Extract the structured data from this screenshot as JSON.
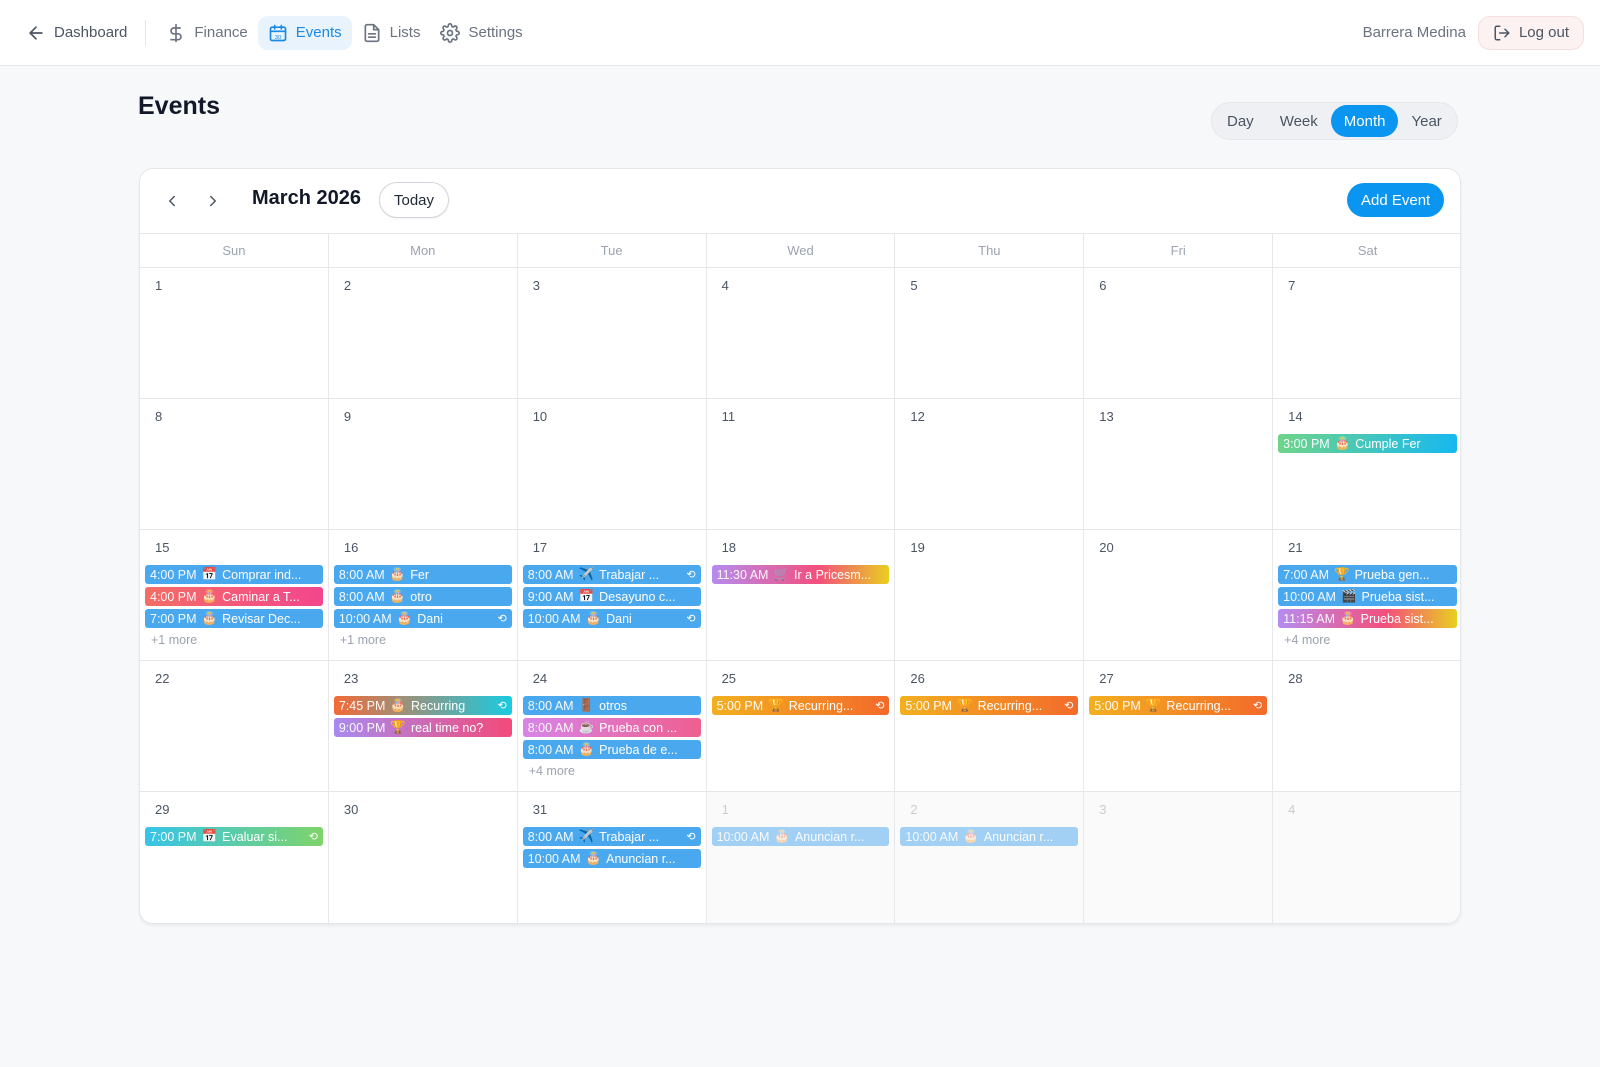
{
  "nav": {
    "back_label": "Dashboard",
    "items": [
      {
        "label": "Finance",
        "icon": "dollar-icon"
      },
      {
        "label": "Events",
        "icon": "calendar-icon",
        "active": true
      },
      {
        "label": "Lists",
        "icon": "document-icon"
      },
      {
        "label": "Settings",
        "icon": "gear-icon"
      }
    ],
    "user_name": "Barrera Medina",
    "logout_label": "Log out"
  },
  "page": {
    "title": "Events",
    "views": [
      "Day",
      "Week",
      "Month",
      "Year"
    ],
    "active_view": "Month"
  },
  "calendar": {
    "month_label": "March 2026",
    "today_label": "Today",
    "add_label": "Add Event",
    "weekdays": [
      "Sun",
      "Mon",
      "Tue",
      "Wed",
      "Thu",
      "Fri",
      "Sat"
    ],
    "weeks": [
      [
        {
          "num": "1",
          "events": []
        },
        {
          "num": "2",
          "events": []
        },
        {
          "num": "3",
          "events": []
        },
        {
          "num": "4",
          "events": []
        },
        {
          "num": "5",
          "events": []
        },
        {
          "num": "6",
          "events": []
        },
        {
          "num": "7",
          "events": []
        }
      ],
      [
        {
          "num": "8",
          "events": []
        },
        {
          "num": "9",
          "events": []
        },
        {
          "num": "10",
          "events": []
        },
        {
          "num": "11",
          "events": []
        },
        {
          "num": "12",
          "events": []
        },
        {
          "num": "13",
          "events": []
        },
        {
          "num": "14",
          "events": [
            {
              "time": "3:00 PM",
              "emoji": "🎂",
              "title": "Cumple Fer",
              "color": "c-cy2",
              "recurring": false
            }
          ]
        }
      ],
      [
        {
          "num": "15",
          "events": [
            {
              "time": "4:00 PM",
              "emoji": "📅",
              "title": "Comprar ind...",
              "color": "c-blue",
              "recurring": false
            },
            {
              "time": "4:00 PM",
              "emoji": "🎂",
              "title": "Caminar a T...",
              "color": "c-pk",
              "recurring": false
            },
            {
              "time": "7:00 PM",
              "emoji": "🎂",
              "title": "Revisar Dec...",
              "color": "c-blue",
              "recurring": false
            }
          ],
          "more": "+1 more"
        },
        {
          "num": "16",
          "events": [
            {
              "time": "8:00 AM",
              "emoji": "🎂",
              "title": "Fer",
              "color": "c-blue",
              "recurring": false
            },
            {
              "time": "8:00 AM",
              "emoji": "🎂",
              "title": "otro",
              "color": "c-blue",
              "recurring": false
            },
            {
              "time": "10:00 AM",
              "emoji": "🎂",
              "title": "Dani",
              "color": "c-blue",
              "recurring": true
            }
          ],
          "more": "+1 more"
        },
        {
          "num": "17",
          "events": [
            {
              "time": "8:00 AM",
              "emoji": "✈️",
              "title": "Trabajar ...",
              "color": "c-blue",
              "recurring": true
            },
            {
              "time": "9:00 AM",
              "emoji": "📅",
              "title": "Desayuno c...",
              "color": "c-blue",
              "recurring": false
            },
            {
              "time": "10:00 AM",
              "emoji": "🎂",
              "title": "Dani",
              "color": "c-blue",
              "recurring": true
            }
          ]
        },
        {
          "num": "18",
          "events": [
            {
              "time": "11:30 AM",
              "emoji": "🛒",
              "title": "Ir a Pricesm...",
              "color": "c-py",
              "recurring": false
            }
          ]
        },
        {
          "num": "19",
          "events": []
        },
        {
          "num": "20",
          "events": []
        },
        {
          "num": "21",
          "events": [
            {
              "time": "7:00 AM",
              "emoji": "🏆",
              "title": "Prueba gen...",
              "color": "c-blue",
              "recurring": false
            },
            {
              "time": "10:00 AM",
              "emoji": "🎬",
              "title": "Prueba sist...",
              "color": "c-blue",
              "recurring": false
            },
            {
              "time": "11:15 AM",
              "emoji": "🎂",
              "title": "Prueba sist...",
              "color": "c-py",
              "recurring": false
            }
          ],
          "more": "+4 more"
        }
      ],
      [
        {
          "num": "22",
          "events": []
        },
        {
          "num": "23",
          "events": [
            {
              "time": "7:45 PM",
              "emoji": "🎂",
              "title": "Recurring",
              "color": "c-og",
              "recurring": true
            },
            {
              "time": "9:00 PM",
              "emoji": "🏆",
              "title": "real time no?",
              "color": "c-pr",
              "recurring": false
            }
          ]
        },
        {
          "num": "24",
          "events": [
            {
              "time": "8:00 AM",
              "emoji": "🚪",
              "title": "otros",
              "color": "c-blue",
              "recurring": false
            },
            {
              "time": "8:00 AM",
              "emoji": "☕",
              "title": "Prueba con ...",
              "color": "c-pink2",
              "recurring": false
            },
            {
              "time": "8:00 AM",
              "emoji": "🎂",
              "title": "Prueba de e...",
              "color": "c-blue",
              "recurring": false
            }
          ],
          "more": "+4 more"
        },
        {
          "num": "25",
          "events": [
            {
              "time": "5:00 PM",
              "emoji": "🏆",
              "title": "Recurring...",
              "color": "c-ora",
              "recurring": true
            }
          ]
        },
        {
          "num": "26",
          "events": [
            {
              "time": "5:00 PM",
              "emoji": "🏆",
              "title": "Recurring...",
              "color": "c-ora",
              "recurring": true
            }
          ]
        },
        {
          "num": "27",
          "events": [
            {
              "time": "5:00 PM",
              "emoji": "🏆",
              "title": "Recurring...",
              "color": "c-ora",
              "recurring": true
            }
          ]
        },
        {
          "num": "28",
          "events": []
        }
      ],
      [
        {
          "num": "29",
          "events": [
            {
              "time": "7:00 PM",
              "emoji": "📅",
              "title": "Evaluar si...",
              "color": "c-cy",
              "recurring": true
            }
          ]
        },
        {
          "num": "30",
          "events": []
        },
        {
          "num": "31",
          "events": [
            {
              "time": "8:00 AM",
              "emoji": "✈️",
              "title": "Trabajar ...",
              "color": "c-blue",
              "recurring": true
            },
            {
              "time": "10:00 AM",
              "emoji": "🎂",
              "title": "Anuncian r...",
              "color": "c-blue",
              "recurring": false
            }
          ]
        },
        {
          "num": "1",
          "other": true,
          "events": [
            {
              "time": "10:00 AM",
              "emoji": "🎂",
              "title": "Anuncian r...",
              "color": "c-blue",
              "recurring": false
            }
          ]
        },
        {
          "num": "2",
          "other": true,
          "events": [
            {
              "time": "10:00 AM",
              "emoji": "🎂",
              "title": "Anuncian r...",
              "color": "c-blue",
              "recurring": false
            }
          ]
        },
        {
          "num": "3",
          "other": true,
          "events": []
        },
        {
          "num": "4",
          "other": true,
          "events": []
        }
      ]
    ],
    "recurring_glyph": "⟲"
  }
}
